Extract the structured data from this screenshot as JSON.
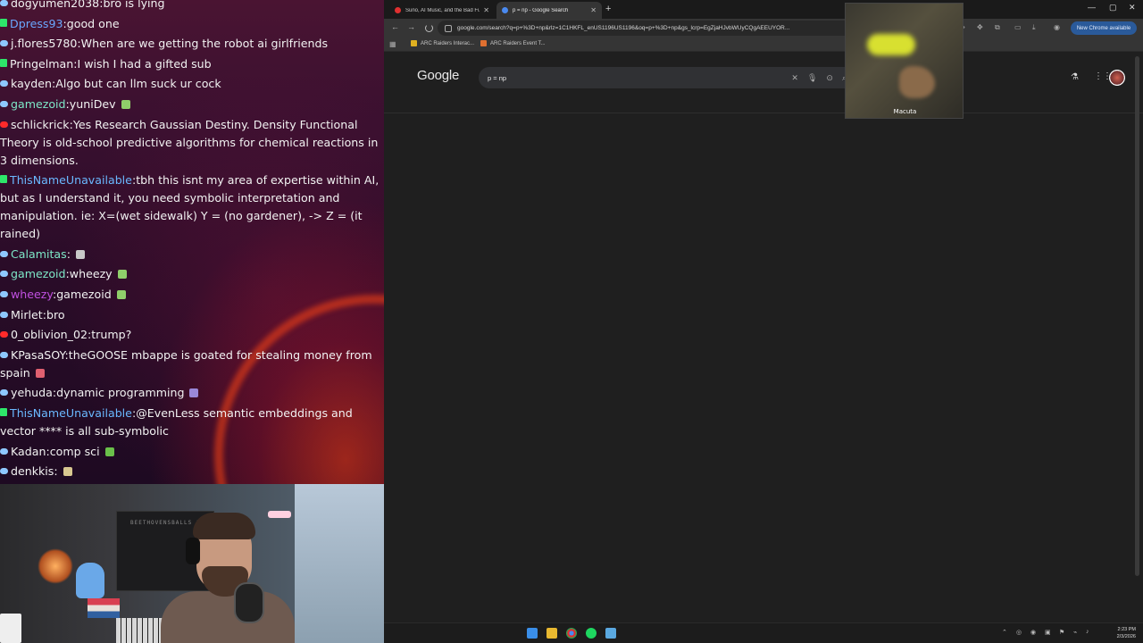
{
  "chat": {
    "messages": [
      {
        "badge": "blue",
        "user": "dogyumen2038",
        "user_color": "#f2f2f2",
        "text": "bro is lying",
        "emote": ""
      },
      {
        "badge": "green",
        "user": "Dpress93",
        "user_color": "#6aa8ff",
        "text": "good one",
        "emote": ""
      },
      {
        "badge": "blue",
        "user": "j.flores5780",
        "user_color": "#f2f2f2",
        "text": "When are we getting the robot ai girlfriends",
        "emote": ""
      },
      {
        "badge": "green",
        "user": "Pringelman",
        "user_color": "#f2f2f2",
        "text": "I wish I had a gifted sub",
        "emote": ""
      },
      {
        "badge": "blue",
        "user": "kayden",
        "user_color": "#f2f2f2",
        "text": "Algo but can llm suck ur cock",
        "emote": ""
      },
      {
        "badge": "blue",
        "user": "gamezoid",
        "user_color": "#7ee8c8",
        "text": "yuniDev",
        "emote": "#8fcf6a"
      },
      {
        "badge": "red",
        "user": "schlickrick",
        "user_color": "#f2f2f2",
        "text": "Yes Research Gaussian Destiny. Density Functional Theory is old-school predictive algorithms for chemical reactions in 3 dimensions.",
        "emote": ""
      },
      {
        "badge": "green",
        "user": "ThisNameUnavailable",
        "user_color": "#6ab8ff",
        "text": "tbh this isnt my area of expertise within AI, but as I understand it, you need symbolic interpretation and manipulation. ie: X=(wet sidewalk) Y = (no gardener), -> Z = (it rained)",
        "emote": ""
      },
      {
        "badge": "blue",
        "user": "Calamitas",
        "user_color": "#7ee8c8",
        "text": "",
        "emote": "#c8c8c8"
      },
      {
        "badge": "blue",
        "user": "gamezoid",
        "user_color": "#7ee8c8",
        "text": "wheezy",
        "emote": "#8fcf6a"
      },
      {
        "badge": "blue",
        "user": "wheezy",
        "user_color": "#c050e0",
        "text": "gamezoid",
        "emote": "#8fcf6a"
      },
      {
        "badge": "blue",
        "user": "Mirlet",
        "user_color": "#f2f2f2",
        "text": "bro",
        "emote": ""
      },
      {
        "badge": "red",
        "user": "0_oblivion_02",
        "user_color": "#f2f2f2",
        "text": "trump?",
        "emote": ""
      },
      {
        "badge": "blue",
        "user": "KPasaSOY",
        "user_color": "#f2f2f2",
        "text": "theGOOSE mbappe is goated for stealing money from spain",
        "emote": "#e06070"
      },
      {
        "badge": "blue",
        "user": "yehuda",
        "user_color": "#f2f2f2",
        "text": "dynamic programming",
        "emote": "#9a88d8"
      },
      {
        "badge": "green",
        "user": "ThisNameUnavailable",
        "user_color": "#6ab8ff",
        "text": "@EvenLess semantic embeddings and vector **** is all sub-symbolic",
        "emote": ""
      },
      {
        "badge": "blue",
        "user": "Kadan",
        "user_color": "#f2f2f2",
        "text": "comp sci",
        "emote": "#6ac04a"
      },
      {
        "badge": "blue",
        "user": "denkkis",
        "user_color": "#f2f2f2",
        "text": "",
        "emote": "#d8c890"
      }
    ]
  },
  "webcam": {
    "shelf_text": "BEETHOVENSBALLS 1 SUB"
  },
  "browser": {
    "tabs": [
      {
        "title": "Suno, AI Music, and the Bad Fu",
        "active": false
      },
      {
        "title": "p = np - Google Search",
        "active": true
      }
    ],
    "new_tab_glyph": "+",
    "url": "google.com/search?q=p+%3D+np&rlz=1C1HKFL_enUS1196US1196&oq=p+%3D+np&gs_lcrp=EgZjaHJvbWUyCQgAEEUYOR...",
    "chrome_available_label": "New Chrome available",
    "bookmarks": [
      {
        "label": "ARC Raiders Interac...",
        "color": "#e0b020"
      },
      {
        "label": "ARC Raiders Event T...",
        "color": "#e07030"
      }
    ]
  },
  "google": {
    "logo": "Google",
    "query": "p = np"
  },
  "minimap": {
    "label": "Macuta"
  },
  "taskbar": {
    "time": "2:23 PM",
    "date": "2/3/2026"
  },
  "colors": {
    "page_bg": "#1f1f1f",
    "search_box": "#303134",
    "chrome_badge": "#2a5a9a"
  }
}
